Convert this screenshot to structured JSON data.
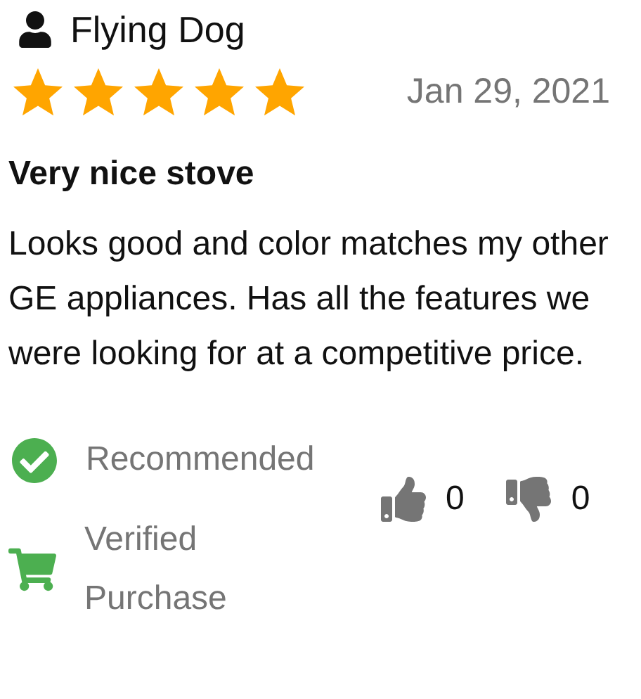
{
  "review": {
    "author": "Flying Dog",
    "stars": 5,
    "date": "Jan 29, 2021",
    "title": "Very nice stove",
    "body": "Looks good and color matches my other GE appliances. Has all the features we were looking for at a competitive price.",
    "recommended": {
      "shown": true,
      "label": "Recommended"
    },
    "verified": {
      "shown": true,
      "label": "Verified Purchase"
    },
    "helpful": {
      "up": "0",
      "down": "0"
    }
  }
}
